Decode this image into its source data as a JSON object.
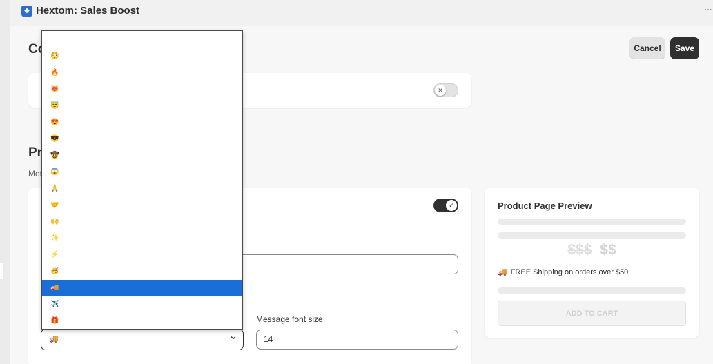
{
  "app": {
    "title": "Hextom: Sales Boost",
    "icon": "app-logo-icon",
    "more_label": "···"
  },
  "header": {
    "section_title_fragment": "Co",
    "cancel_label": "Cancel",
    "save_label": "Save"
  },
  "section2": {
    "title_fragment": "Pr",
    "desc_fragment": "Mot"
  },
  "form": {
    "enable_toggle": "on",
    "top_toggle": "off",
    "message_font_size_label": "Message font size",
    "message_font_size_value": "14",
    "icon_select_value": "🚚"
  },
  "dropdown": {
    "options": [
      "",
      "😳",
      "🔥",
      "😻",
      "😇",
      "😍",
      "😎",
      "🤠",
      "😱",
      "🙏",
      "🤝",
      "🙌",
      "✨",
      "⚡",
      "🥳",
      "🚚",
      "✈️",
      "🎁"
    ],
    "selected_index": 15
  },
  "preview": {
    "title": "Product Page Preview",
    "old_price": "$$$",
    "new_price": "$$",
    "shipping_icon": "🚚",
    "shipping_text": "FREE Shipping on orders over $50",
    "add_to_cart": "ADD TO CART"
  },
  "colors": {
    "accent": "#303030",
    "selected_option": "#1a6ed8",
    "app_icon": "#2c6ecb"
  }
}
